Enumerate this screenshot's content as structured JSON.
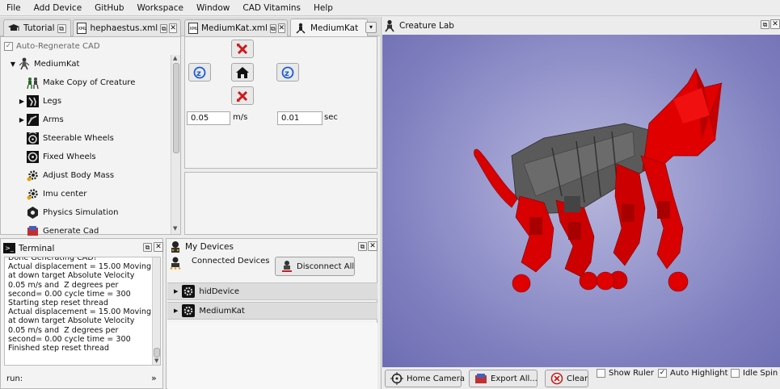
{
  "menu": [
    "File",
    "Add Device",
    "GitHub",
    "Workspace",
    "Window",
    "CAD Vitamins",
    "Help"
  ],
  "left_tabs": [
    {
      "label": "Tutorial",
      "icon": "graduation-cap-icon"
    },
    {
      "label": "hephaestus.xml",
      "icon": "xml-file-icon"
    },
    {
      "label": "MediumKat.xml",
      "icon": "xml-file-icon"
    },
    {
      "label": "MediumKat",
      "icon": "creature-icon"
    }
  ],
  "tree": {
    "auto_regen": "Auto-Regnerate CAD",
    "auto_regen_checked": true,
    "root": "MediumKat",
    "items": [
      {
        "label": "Make Copy of Creature",
        "icon": "copy-creature-icon",
        "expandable": false
      },
      {
        "label": "Legs",
        "icon": "legs-icon",
        "expandable": true
      },
      {
        "label": "Arms",
        "icon": "arms-icon",
        "expandable": true
      },
      {
        "label": "Steerable Wheels",
        "icon": "steerable-wheel-icon",
        "expandable": false
      },
      {
        "label": "Fixed Wheels",
        "icon": "fixed-wheel-icon",
        "expandable": false
      },
      {
        "label": "Adjust Body Mass",
        "icon": "gear-icon",
        "expandable": false
      },
      {
        "label": "Imu center",
        "icon": "gear-icon",
        "expandable": false
      },
      {
        "label": "Physics Simulation",
        "icon": "physics-icon",
        "expandable": false
      },
      {
        "label": "Generate Cad",
        "icon": "cad-icon",
        "expandable": false
      }
    ]
  },
  "jog": {
    "speed_value": "0.05",
    "speed_unit": "m/s",
    "time_value": "0.01",
    "time_unit": "sec"
  },
  "terminal": {
    "title": "Terminal",
    "text": "Done Generating CAD!\nActual displacement = 15.00 Moving at down target Absolute Velocity 0.05 m/s and  Z degrees per second= 0.00 cycle time = 300\nStarting step reset thread\nActual displacement = 15.00 Moving at down target Absolute Velocity 0.05 m/s and  Z degrees per second= 0.00 cycle time = 300\nFinished step reset thread",
    "run_label": "run:",
    "run_arrow": "»"
  },
  "devices": {
    "title": "My Devices",
    "connected_label": "Connected Devices",
    "disconnect_label": "Disconnect All",
    "list": [
      "hidDevice",
      "MediumKat"
    ]
  },
  "creature_lab": {
    "title": "Creature Lab",
    "home_camera": "Home Camera",
    "export_all": "Export All...",
    "clear": "Clear",
    "show_ruler": "Show Ruler",
    "show_ruler_checked": false,
    "auto_highlight": "Auto Highlight",
    "auto_highlight_checked": true,
    "idle_spin": "Idle Spin",
    "idle_spin_checked": false
  },
  "colors": {
    "robot_red": "#e00000",
    "robot_gray": "#555555",
    "view_bg": "#9c9cd0"
  }
}
